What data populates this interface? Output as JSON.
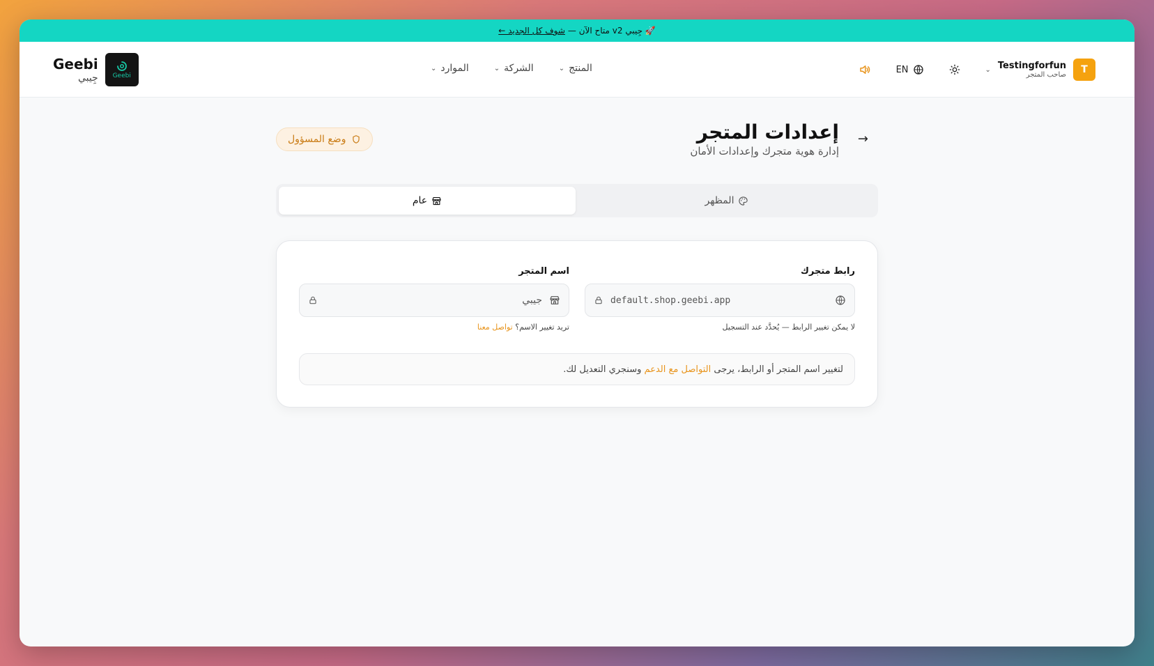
{
  "announcement": {
    "text": "🚀 جِيبي v2 متاح الآن —",
    "link": "شوف كل الجديد ←"
  },
  "brand": {
    "name": "Geebi",
    "arabic": "جِيبي",
    "logo_text": "Geebi"
  },
  "nav": {
    "items": [
      {
        "label": "الموارد"
      },
      {
        "label": "الشركة"
      },
      {
        "label": "المنتج"
      }
    ]
  },
  "header": {
    "user_name": "Testingforfun",
    "user_role": "صاحب المتجر",
    "avatar": "T",
    "lang": "EN",
    "icons": [
      "chevron-down-icon",
      "sun-icon",
      "globe-icon",
      "speaker-icon"
    ]
  },
  "page": {
    "title": "إعدادات المتجر",
    "subtitle": "إدارة هوية متجرك وإعدادات الأمان",
    "admin_mode": "وضع المسؤول"
  },
  "tabs": [
    {
      "label": "المظهر",
      "icon": "palette-icon"
    },
    {
      "label": "عام",
      "icon": "store-icon",
      "active": true
    }
  ],
  "form": {
    "store_link_label": "رابط متجرك",
    "store_link_value": "default.shop.geebi.app",
    "store_link_hint": "لا يمكن تغيير الرابط — يُحدَّد عند التسجيل",
    "store_name_label": "اسم المتجر",
    "store_name_value": "جيبي",
    "store_name_hint": "تريد تغيير الاسم؟",
    "store_name_hint_link": "تواصل معنا",
    "notice_prefix": "لتغيير اسم المتجر أو الرابط، يرجى",
    "notice_link": "التواصل مع الدعم",
    "notice_suffix": "وسنجري التعديل لك."
  },
  "colors": {
    "accent": "#e8941c",
    "banner": "#14d6c3",
    "avatar": "#f5a20f"
  }
}
